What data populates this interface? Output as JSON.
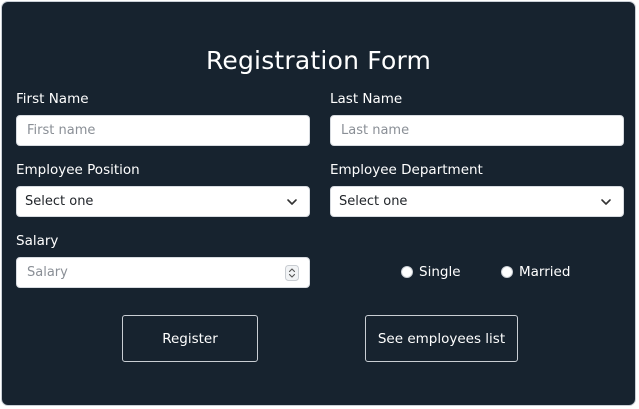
{
  "form": {
    "title": "Registration Form",
    "first_name": {
      "label": "First Name",
      "placeholder": "First name",
      "value": ""
    },
    "last_name": {
      "label": "Last Name",
      "placeholder": "Last name",
      "value": ""
    },
    "position": {
      "label": "Employee Position",
      "selected": "Select one"
    },
    "department": {
      "label": "Employee Department",
      "selected": "Select one"
    },
    "salary": {
      "label": "Salary",
      "placeholder": "Salary",
      "value": ""
    },
    "marital_status": {
      "options": [
        {
          "label": "Single",
          "checked": false
        },
        {
          "label": "Married",
          "checked": false
        }
      ]
    },
    "buttons": {
      "register": "Register",
      "see_list": "See employees list"
    }
  },
  "icons": {
    "select_chevron": "chevron-down-icon",
    "number_spinner": "spinner-arrows-icon"
  },
  "colors": {
    "background": "#17232f",
    "text": "#ffffff",
    "field_background": "#ffffff",
    "border": "#c9ced4"
  }
}
